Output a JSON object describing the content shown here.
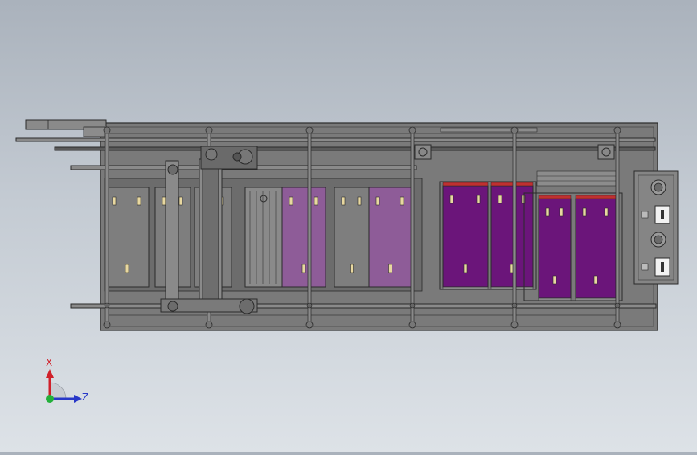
{
  "viewport": {
    "background_top": "#aab2bc",
    "background_bottom": "#dde2e7"
  },
  "machine": {
    "frame_color": "#7a7a7a",
    "line_color": "#2a2a2a",
    "stations": [
      {
        "kind": "gray-panel"
      },
      {
        "kind": "gray-panel"
      },
      {
        "kind": "gray-panel"
      },
      {
        "kind": "roller-module"
      },
      {
        "kind": "lavender-tank"
      },
      {
        "kind": "gray-panel"
      },
      {
        "kind": "lavender-tank"
      },
      {
        "kind": "purple-tank"
      },
      {
        "kind": "purple-tank"
      },
      {
        "kind": "purple-tank"
      },
      {
        "kind": "purple-tank"
      }
    ],
    "tank_colors": {
      "gray": "#7e7e7e",
      "lavender": "#8e5c98",
      "purple": "#6b157a"
    },
    "control_box": {
      "knobs": 2,
      "switches": 2
    }
  },
  "triad": {
    "x_label": "X",
    "z_label": "Z",
    "x_color": "#d0202a",
    "z_color": "#2838c8",
    "y_color": "#22b03a"
  }
}
